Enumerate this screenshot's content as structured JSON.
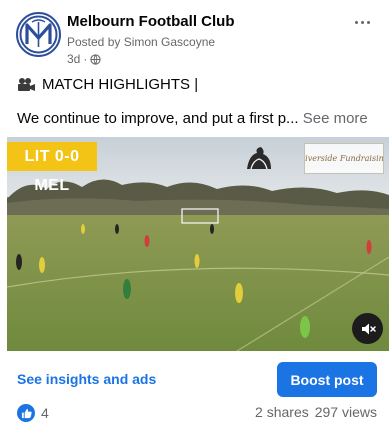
{
  "post": {
    "page_name": "Melbourn Football Club",
    "posted_by": "Posted by Simon Gascoyne",
    "time": "3d",
    "separator": "·",
    "privacy_icon": "globe-icon",
    "more_icon": "more-options-icon",
    "headline_icon": "movie-camera-icon",
    "headline": "MATCH HIGHLIGHTS |",
    "body_text": "We continue to improve, and put a first p...",
    "see_more": "See more"
  },
  "video": {
    "score_text": "LIT 0-0 MEL",
    "score_color": "#f3c316",
    "sponsor_text": "Riverside Fundraising",
    "mute_icon": "muted-speaker-icon"
  },
  "actions": {
    "insights_link": "See insights and ads",
    "boost_label": "Boost post",
    "accent_color": "#1b74e4"
  },
  "engagement": {
    "like_icon": "thumbs-up-icon",
    "reaction_count": "4",
    "shares": "2 shares",
    "views": "297 views"
  }
}
